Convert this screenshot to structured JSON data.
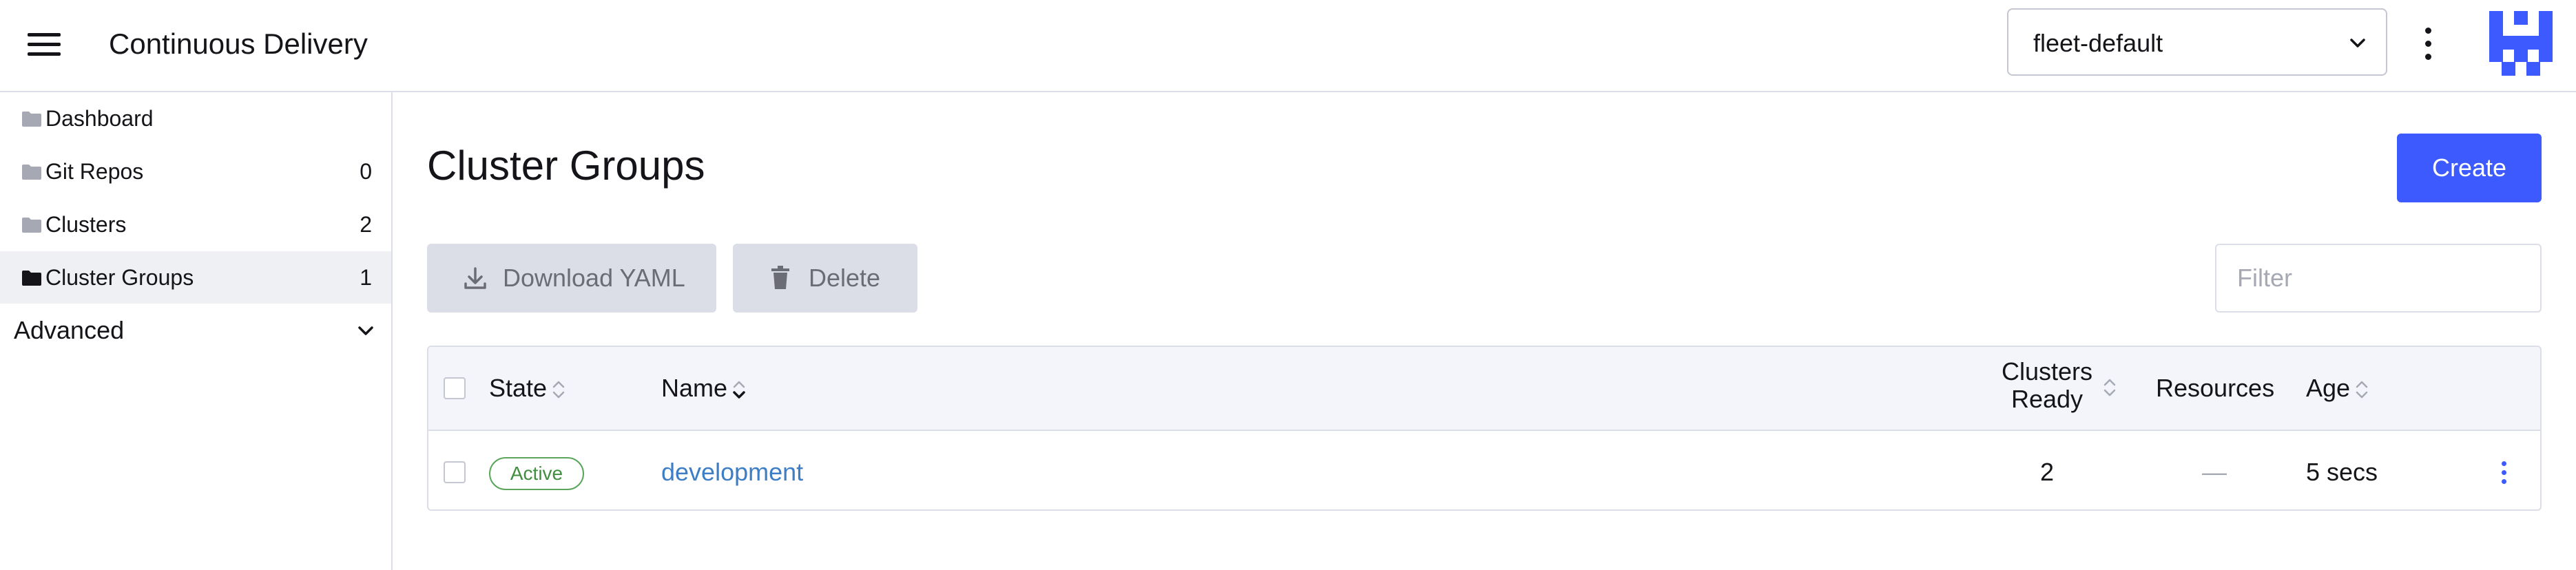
{
  "header": {
    "title": "Continuous Delivery",
    "workspace_select": {
      "value": "fleet-default"
    }
  },
  "sidebar": {
    "items": [
      {
        "label": "Dashboard",
        "count": ""
      },
      {
        "label": "Git Repos",
        "count": "0"
      },
      {
        "label": "Clusters",
        "count": "2"
      },
      {
        "label": "Cluster Groups",
        "count": "1"
      }
    ],
    "group": {
      "label": "Advanced"
    }
  },
  "main": {
    "title": "Cluster Groups",
    "create_label": "Create",
    "download_label": "Download YAML",
    "delete_label": "Delete",
    "filter_placeholder": "Filter"
  },
  "table": {
    "headers": {
      "state": "State",
      "name": "Name",
      "clusters_ready_line1": "Clusters",
      "clusters_ready_line2": "Ready",
      "resources": "Resources",
      "age": "Age"
    },
    "rows": [
      {
        "state": "Active",
        "name": "development",
        "clusters_ready": "2",
        "resources": "—",
        "age": "5 secs"
      }
    ]
  },
  "colors": {
    "accent": "#3d5afe",
    "link": "#3d7ec6",
    "active_badge": "#3f8f3f",
    "active_nav_bg": "#eef0f4"
  }
}
